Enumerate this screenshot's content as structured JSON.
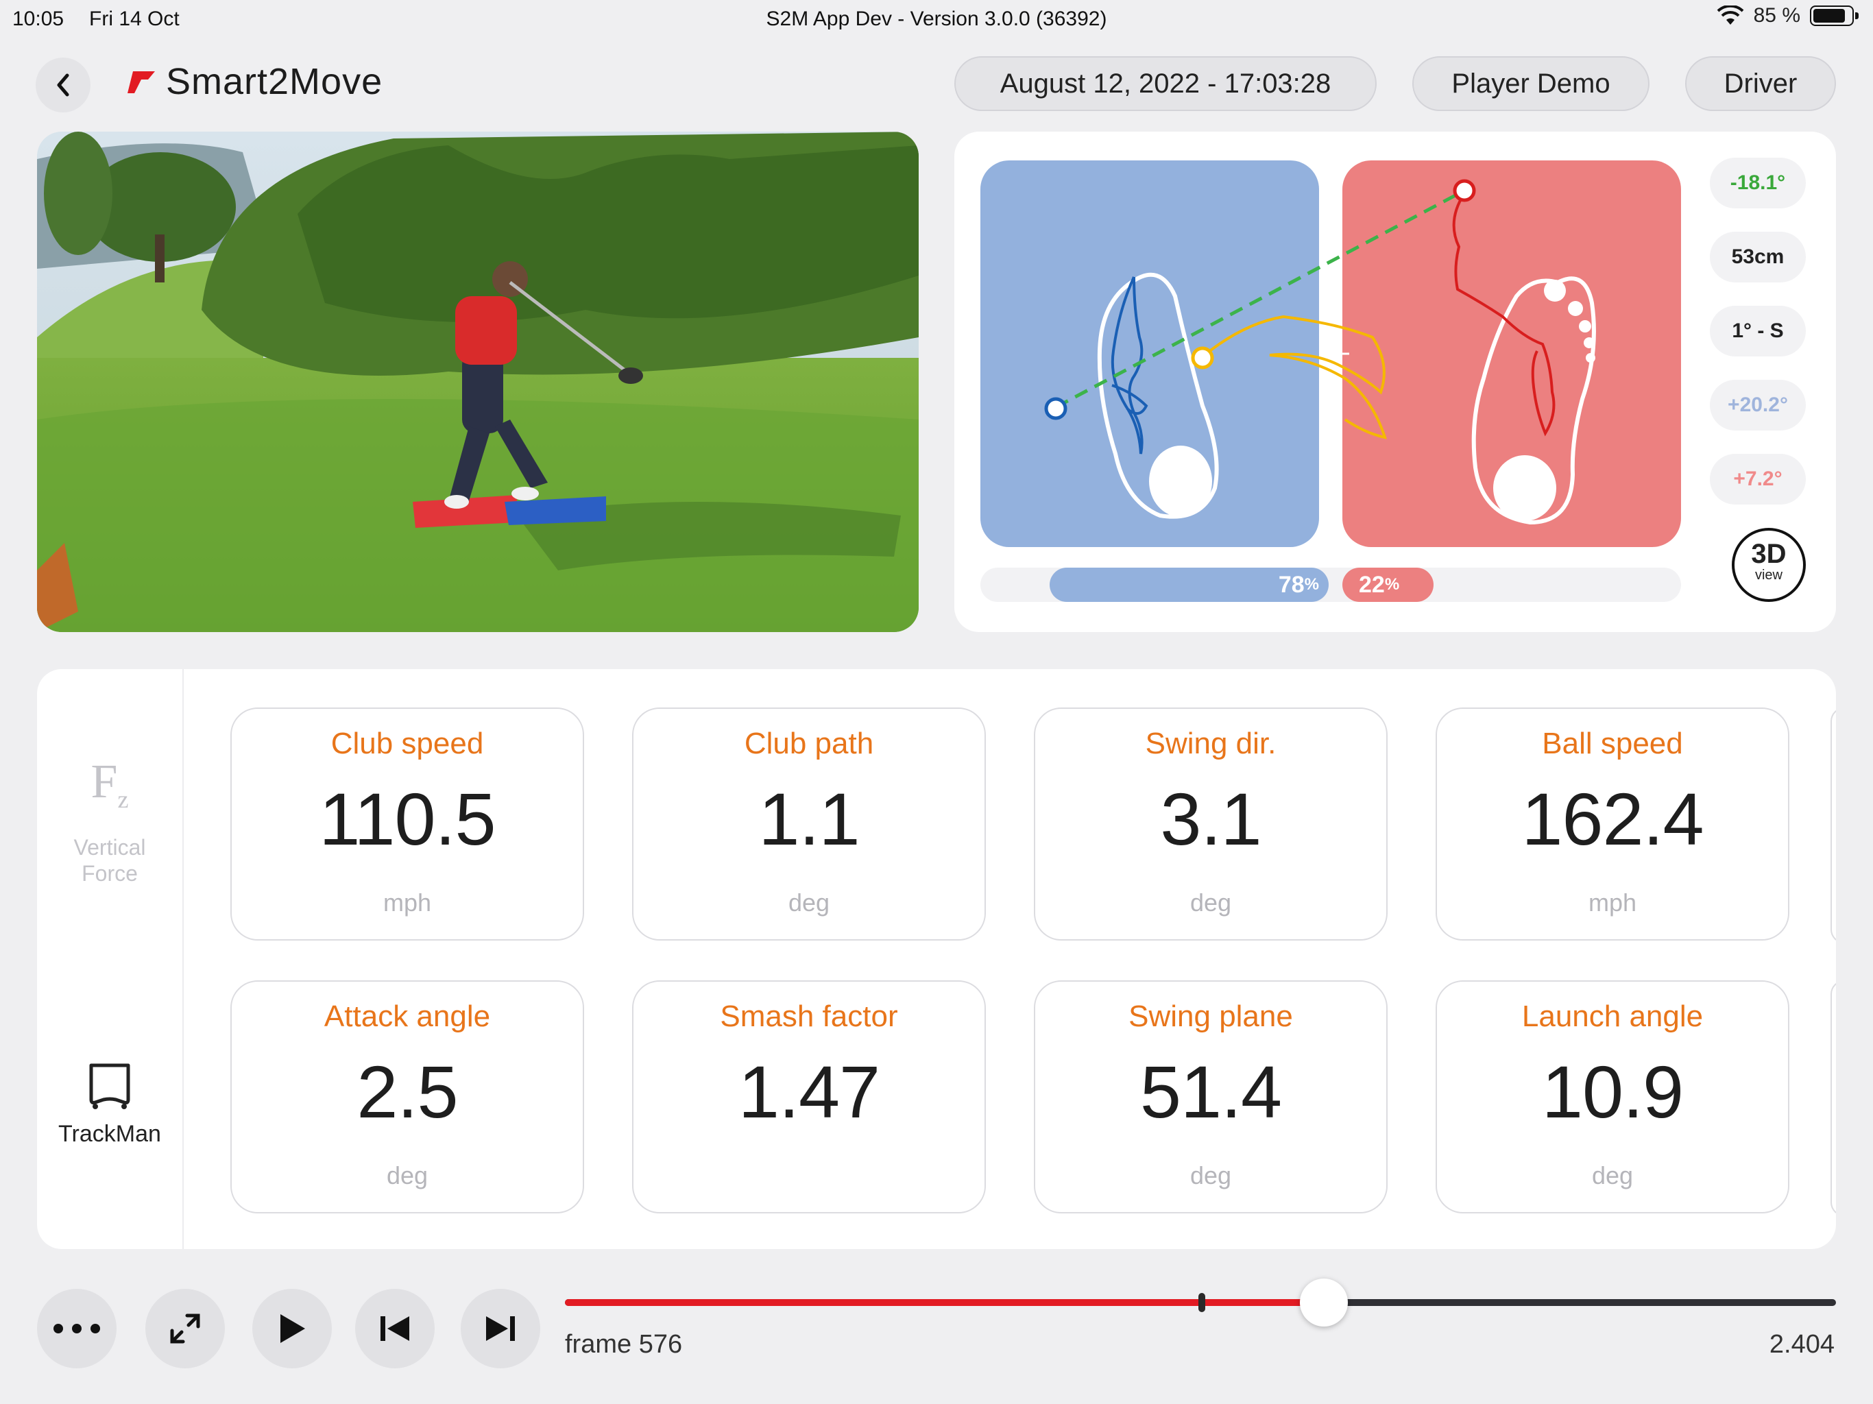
{
  "status": {
    "time": "10:05",
    "date": "Fri 14 Oct",
    "title": "S2M App Dev - Version 3.0.0 (36392)",
    "battery": "85 %",
    "battery_level": 0.85
  },
  "header": {
    "brand": "Smart2Move",
    "session_date": "August 12, 2022 - 17:03:28",
    "player": "Player Demo",
    "club": "Driver"
  },
  "pressure": {
    "left_percent": "78",
    "right_percent": "22",
    "percent_sign": "%",
    "left_share": 0.78,
    "right_share": 0.22,
    "badges": [
      {
        "text": "-18.1°",
        "color": "#3aa83a"
      },
      {
        "text": "53cm",
        "color": "#222222"
      },
      {
        "text": "1° - S",
        "color": "#222222"
      },
      {
        "text": "+20.2°",
        "color": "#9fb4dc"
      },
      {
        "text": "+7.2°",
        "color": "#f08a8a"
      }
    ],
    "view3d_main": "3D",
    "view3d_sub": "view",
    "colors": {
      "left": "#93b1dd",
      "right": "#ec8080",
      "left_trace": "#1a5fb4",
      "right_trace": "#d81e1e",
      "cog_trace": "#f5b800",
      "axis": "#3cb34a"
    }
  },
  "sidebar": {
    "vertical_force_symbol": "F",
    "vertical_force_sub": "z",
    "vertical_force_label1": "Vertical",
    "vertical_force_label2": "Force",
    "trackman_label": "TrackMan"
  },
  "metrics": [
    {
      "label": "Club speed",
      "value": "110.5",
      "unit": "mph"
    },
    {
      "label": "Club path",
      "value": "1.1",
      "unit": "deg"
    },
    {
      "label": "Swing dir.",
      "value": "3.1",
      "unit": "deg"
    },
    {
      "label": "Ball speed",
      "value": "162.4",
      "unit": "mph"
    },
    {
      "label": "Attack angle",
      "value": "2.5",
      "unit": "deg"
    },
    {
      "label": "Smash factor",
      "value": "1.47",
      "unit": ""
    },
    {
      "label": "Swing plane",
      "value": "51.4",
      "unit": "deg"
    },
    {
      "label": "Launch angle",
      "value": "10.9",
      "unit": "deg"
    }
  ],
  "playback": {
    "frame": "frame 576",
    "time": "2.404",
    "progress": 0.597,
    "marker": 0.501
  }
}
